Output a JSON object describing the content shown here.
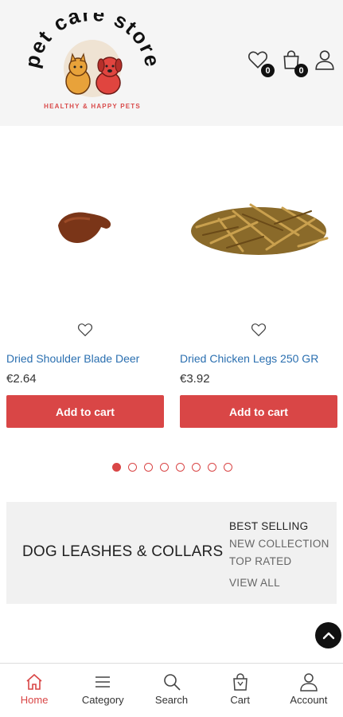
{
  "header": {
    "logo_text": "pet care store",
    "logo_tagline": "HEALTHY & HAPPY PETS",
    "wishlist_count": "0",
    "cart_count": "0"
  },
  "products": [
    {
      "name": "Dried Shoulder Blade Deer",
      "price": "€2.64",
      "button": "Add to cart"
    },
    {
      "name": "Dried Chicken Legs 250 GR",
      "price": "€3.92",
      "button": "Add to cart"
    }
  ],
  "carousel": {
    "total": 8,
    "active_index": 0
  },
  "category_block": {
    "title": "DOG LEASHES & COLLARS",
    "links": [
      "BEST SELLING",
      "NEW COLLECTION",
      "TOP RATED"
    ],
    "view_all": "VIEW ALL"
  },
  "bottom_nav": {
    "items": [
      {
        "label": "Home",
        "icon": "home-icon"
      },
      {
        "label": "Category",
        "icon": "menu-icon"
      },
      {
        "label": "Search",
        "icon": "search-icon"
      },
      {
        "label": "Cart",
        "icon": "cart-icon"
      },
      {
        "label": "Account",
        "icon": "user-icon"
      }
    ],
    "active": "Home"
  },
  "colors": {
    "accent": "#d94646",
    "link": "#2a6fb0",
    "header_bg": "#f5f5f5",
    "category_bg": "#f1f1f1"
  }
}
